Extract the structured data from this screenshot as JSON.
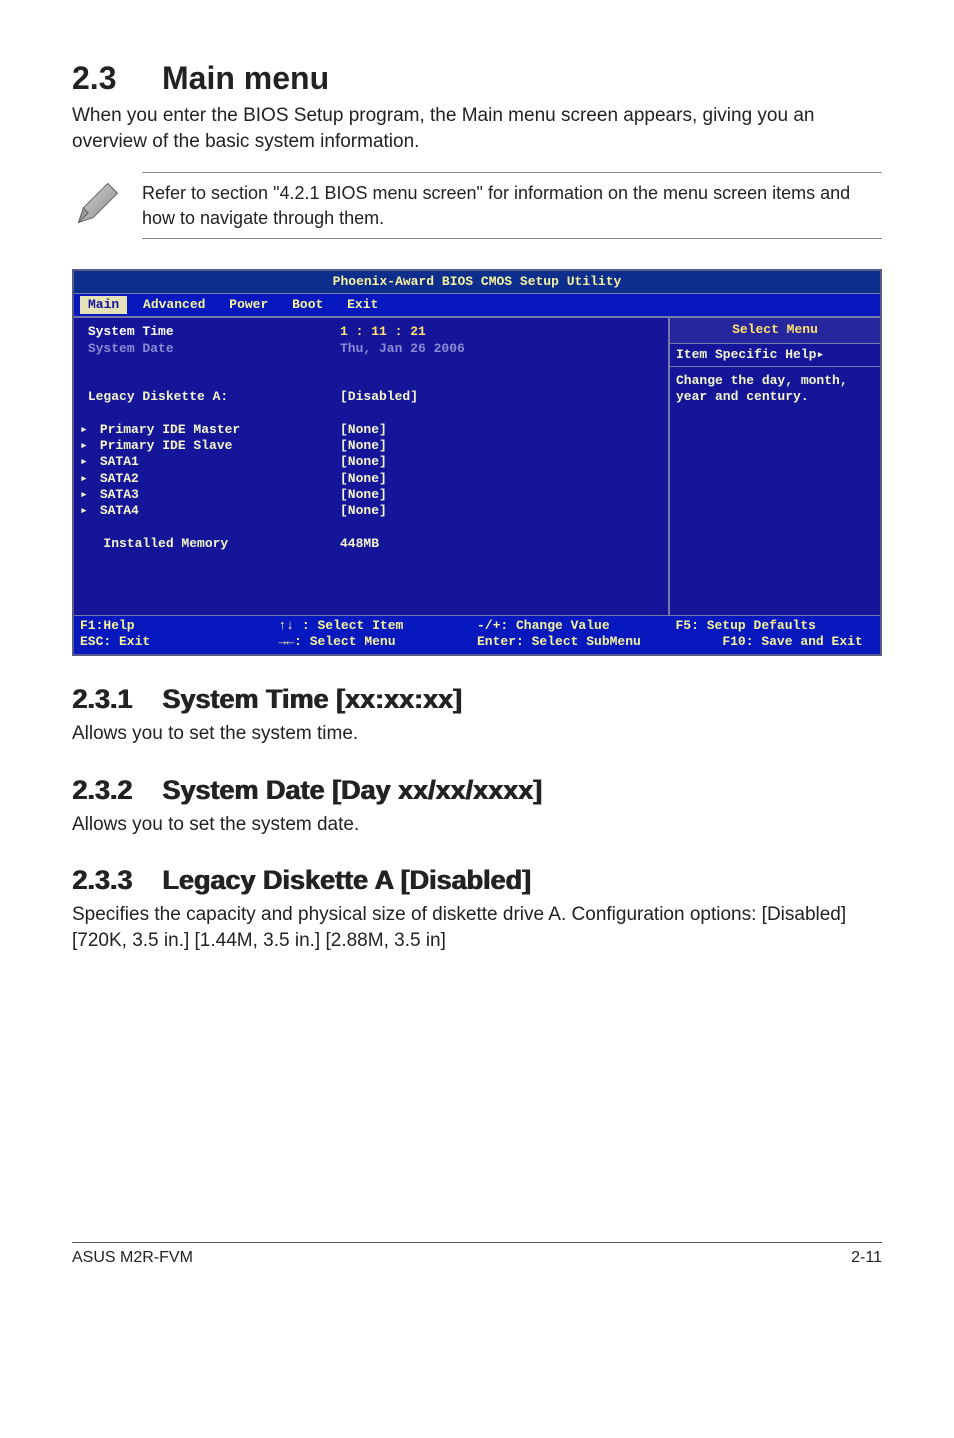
{
  "heading": {
    "num": "2.3",
    "title": "Main menu"
  },
  "intro": "When you enter the BIOS Setup program, the Main menu screen appears, giving you an overview of the basic system information.",
  "note": "Refer to section \"4.2.1 BIOS menu screen\" for information on the menu screen items and how to navigate through them.",
  "bios": {
    "title": "Phoenix-Award BIOS CMOS Setup Utility",
    "tabs": [
      "Main",
      "Advanced",
      "Power",
      "Boot",
      "Exit"
    ],
    "active_tab_index": 0,
    "left": {
      "system_time_label": "System Time",
      "system_time_value": "1 : 11 : 21",
      "system_date_label": "System Date",
      "system_date_value": "Thu, Jan 26 2006",
      "legacy_label": "Legacy Diskette A:",
      "legacy_value": "[Disabled]",
      "items": [
        {
          "label": "Primary IDE Master",
          "value": "[None]"
        },
        {
          "label": "Primary IDE Slave",
          "value": "[None]"
        },
        {
          "label": "SATA1",
          "value": "[None]"
        },
        {
          "label": "SATA2",
          "value": "[None]"
        },
        {
          "label": "SATA3",
          "value": "[None]"
        },
        {
          "label": "SATA4",
          "value": "[None]"
        }
      ],
      "installed_mem_label": "Installed Memory",
      "installed_mem_value": "448MB"
    },
    "right": {
      "title": "Select Menu",
      "subtitle": "Item Specific Help",
      "help": "Change the day, month, year and century."
    },
    "footer": {
      "c1a": "F1:Help",
      "c1b": "ESC: Exit",
      "c2a": "↑↓ : Select Item",
      "c2b": "→←: Select Menu",
      "c3a": "-/+: Change Value",
      "c3b": "Enter: Select SubMenu",
      "c4a": "F5: Setup Defaults",
      "c4b": "F10: Save and Exit"
    }
  },
  "sections": [
    {
      "num": "2.3.1",
      "title": "System Time [xx:xx:xx]",
      "body": "Allows you to set the system time."
    },
    {
      "num": "2.3.2",
      "title": "System Date [Day xx/xx/xxxx]",
      "body": "Allows you to set the system date."
    },
    {
      "num": "2.3.3",
      "title": "Legacy Diskette A [Disabled]",
      "body": "Specifies the capacity and physical size of diskette drive A. Configuration options: [Disabled] [720K, 3.5 in.] [1.44M, 3.5 in.] [2.88M, 3.5 in]"
    }
  ],
  "footer": {
    "left": "ASUS M2R-FVM",
    "right": "2-11"
  }
}
